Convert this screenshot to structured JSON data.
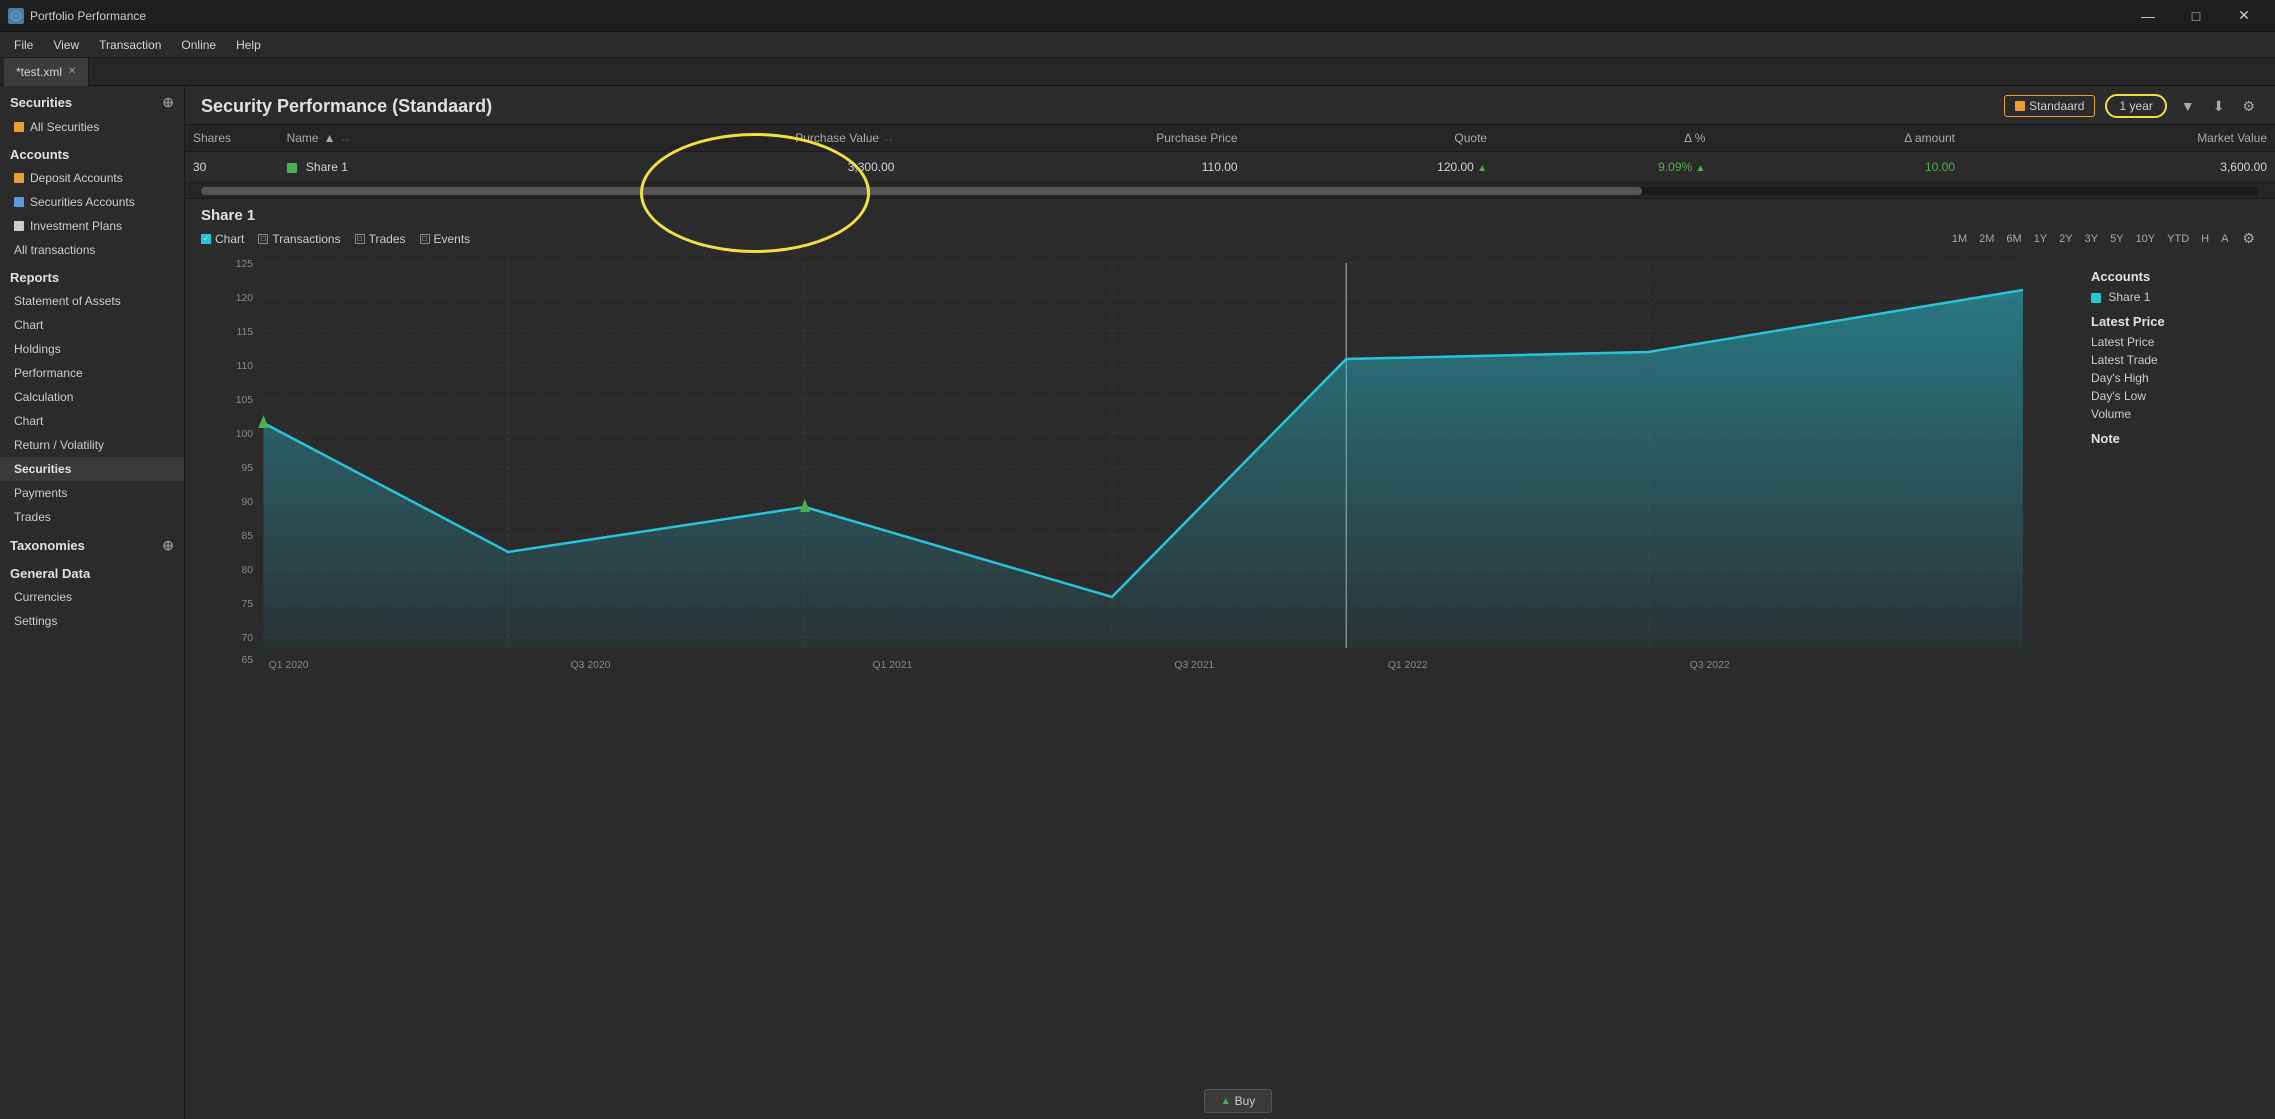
{
  "app": {
    "title": "Portfolio Performance",
    "tab": "*test.xml",
    "menu": [
      "File",
      "View",
      "Transaction",
      "Online",
      "Help"
    ]
  },
  "sidebar": {
    "securities_section": "Securities",
    "all_securities": "All Securities",
    "accounts_section": "Accounts",
    "deposit_accounts": "Deposit Accounts",
    "securities_accounts": "Securities Accounts",
    "investment_plans": "Investment Plans",
    "all_transactions": "All transactions",
    "reports_section": "Reports",
    "statement_of_assets": "Statement of Assets",
    "chart_1": "Chart",
    "holdings": "Holdings",
    "performance": "Performance",
    "calculation": "Calculation",
    "chart_2": "Chart",
    "return_volatility": "Return / Volatility",
    "securities_subsection": "Securities",
    "payments": "Payments",
    "trades": "Trades",
    "taxonomies_section": "Taxonomies",
    "general_data_section": "General Data",
    "currencies": "Currencies",
    "settings": "Settings"
  },
  "main": {
    "title": "Security Performance (Standaard)",
    "view_btn": "Standaard",
    "year_btn": "1 year",
    "table": {
      "columns": [
        "Shares",
        "Name",
        "",
        "Purchase Value",
        "",
        "Purchase Price",
        "Quote",
        "Δ %",
        "Δ amount",
        "Market Value"
      ],
      "rows": [
        {
          "shares": "30",
          "name": "Share 1",
          "purchase_value": "3,300.00",
          "purchase_price": "110.00",
          "quote": "120.00",
          "delta_pct": "9.09%",
          "delta_amount": "10.00",
          "market_value": "3,600.00"
        }
      ]
    }
  },
  "chart": {
    "title": "Share 1",
    "checkboxes": [
      "Chart",
      "Transactions",
      "Trades",
      "Events"
    ],
    "time_periods": [
      "1M",
      "2M",
      "6M",
      "1Y",
      "2Y",
      "3Y",
      "5Y",
      "10Y",
      "YTD",
      "H",
      "A"
    ],
    "x_labels": [
      "Q1 2020",
      "Q3 2020",
      "Q1 2021",
      "Q3 2021",
      "Q1 2022",
      "Q3 2022"
    ],
    "y_labels": [
      "125",
      "120",
      "115",
      "110",
      "105",
      "100",
      "95",
      "90",
      "85",
      "80",
      "75",
      "70",
      "65"
    ],
    "sidebar": {
      "accounts_label": "Accounts",
      "share1": "Share 1",
      "latest_price_section": "Latest Price",
      "latest_price": "Latest Price",
      "latest_trade": "Latest Trade",
      "days_high": "Day's High",
      "days_low": "Day's Low",
      "volume": "Volume",
      "note_label": "Note"
    }
  },
  "buy_btn": "Buy",
  "icons": {
    "up_triangle": "▲",
    "down_triangle": "▼",
    "small_triangle": "▸",
    "settings": "⚙",
    "download": "⬇",
    "filter": "▼",
    "add": "⊕",
    "sort_asc": "▲",
    "resize": "↔"
  }
}
